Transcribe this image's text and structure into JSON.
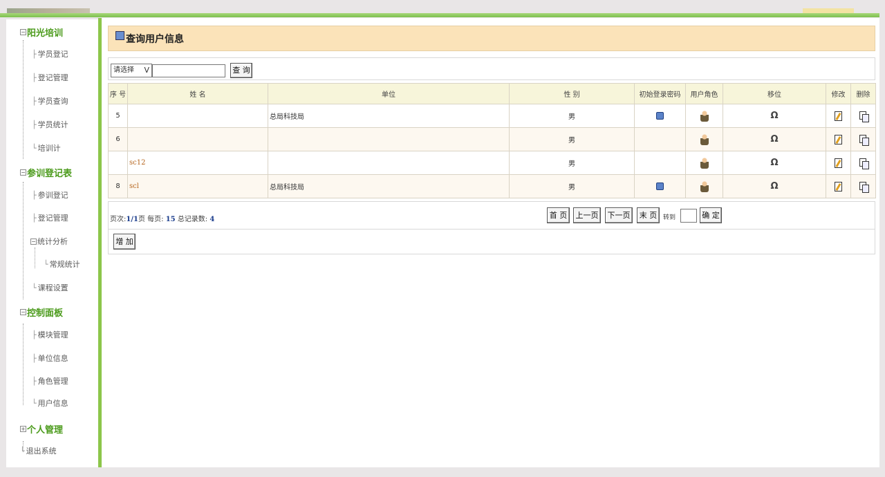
{
  "sidebar": {
    "groups": [
      {
        "label": "阳光培训",
        "icon": "minus",
        "items": [
          "学员登记",
          "登记管理",
          "学员查询",
          "学员统计",
          "培训计"
        ]
      },
      {
        "label": "参训登记表",
        "icon": "minus",
        "items": [
          "参训登记",
          "登记管理",
          "统计分析",
          "常规统计",
          "课程设置"
        ]
      },
      {
        "label": "控制面板",
        "icon": "minus",
        "items": [
          "模块管理",
          "单位信息",
          "角色管理",
          "用户信息"
        ]
      },
      {
        "label": "个人管理",
        "icon": "plus",
        "items": []
      }
    ],
    "logout": "退出系统"
  },
  "main": {
    "title": "查询用户信息",
    "search": {
      "select_value": "请选择",
      "select_arrow": "V",
      "query_button": "查 询"
    },
    "table": {
      "headers": [
        "序 号",
        "姓 名",
        "单位",
        "性 别",
        "初始登录密码",
        "用户角色",
        "移位",
        "修改",
        "删除"
      ],
      "rows": [
        {
          "seq": "5",
          "name": "",
          "unit": "总局科技局",
          "gender": "男",
          "has_pwd": true
        },
        {
          "seq": "6",
          "name": "",
          "unit": "",
          "gender": "男",
          "has_pwd": false
        },
        {
          "seq": "",
          "name": "sc12",
          "unit": "",
          "gender": "男",
          "has_pwd": false
        },
        {
          "seq": "8",
          "name": "scl",
          "unit": "总局科技局",
          "gender": "男",
          "has_pwd": true
        }
      ]
    },
    "pager": {
      "page_label": "页次:",
      "page_value": "1/1",
      "page_unit": "页",
      "per_page_label": "每页:",
      "per_page_value": "15",
      "total_label": "总记录数:",
      "total_value": "4",
      "buttons": {
        "first": "首 页",
        "prev": "上一页",
        "next": "下一页",
        "last": "末 页",
        "goto_label": "转到",
        "confirm": "确 定"
      }
    },
    "add_button": "增 加"
  },
  "colors": {
    "accent_green": "#8cc64a",
    "group_text": "#4a9a1a",
    "title_bg": "#fbe3b9",
    "header_bg": "#f7f5da",
    "name_link": "#b5651d",
    "pager_number": "#1a3c8c"
  }
}
